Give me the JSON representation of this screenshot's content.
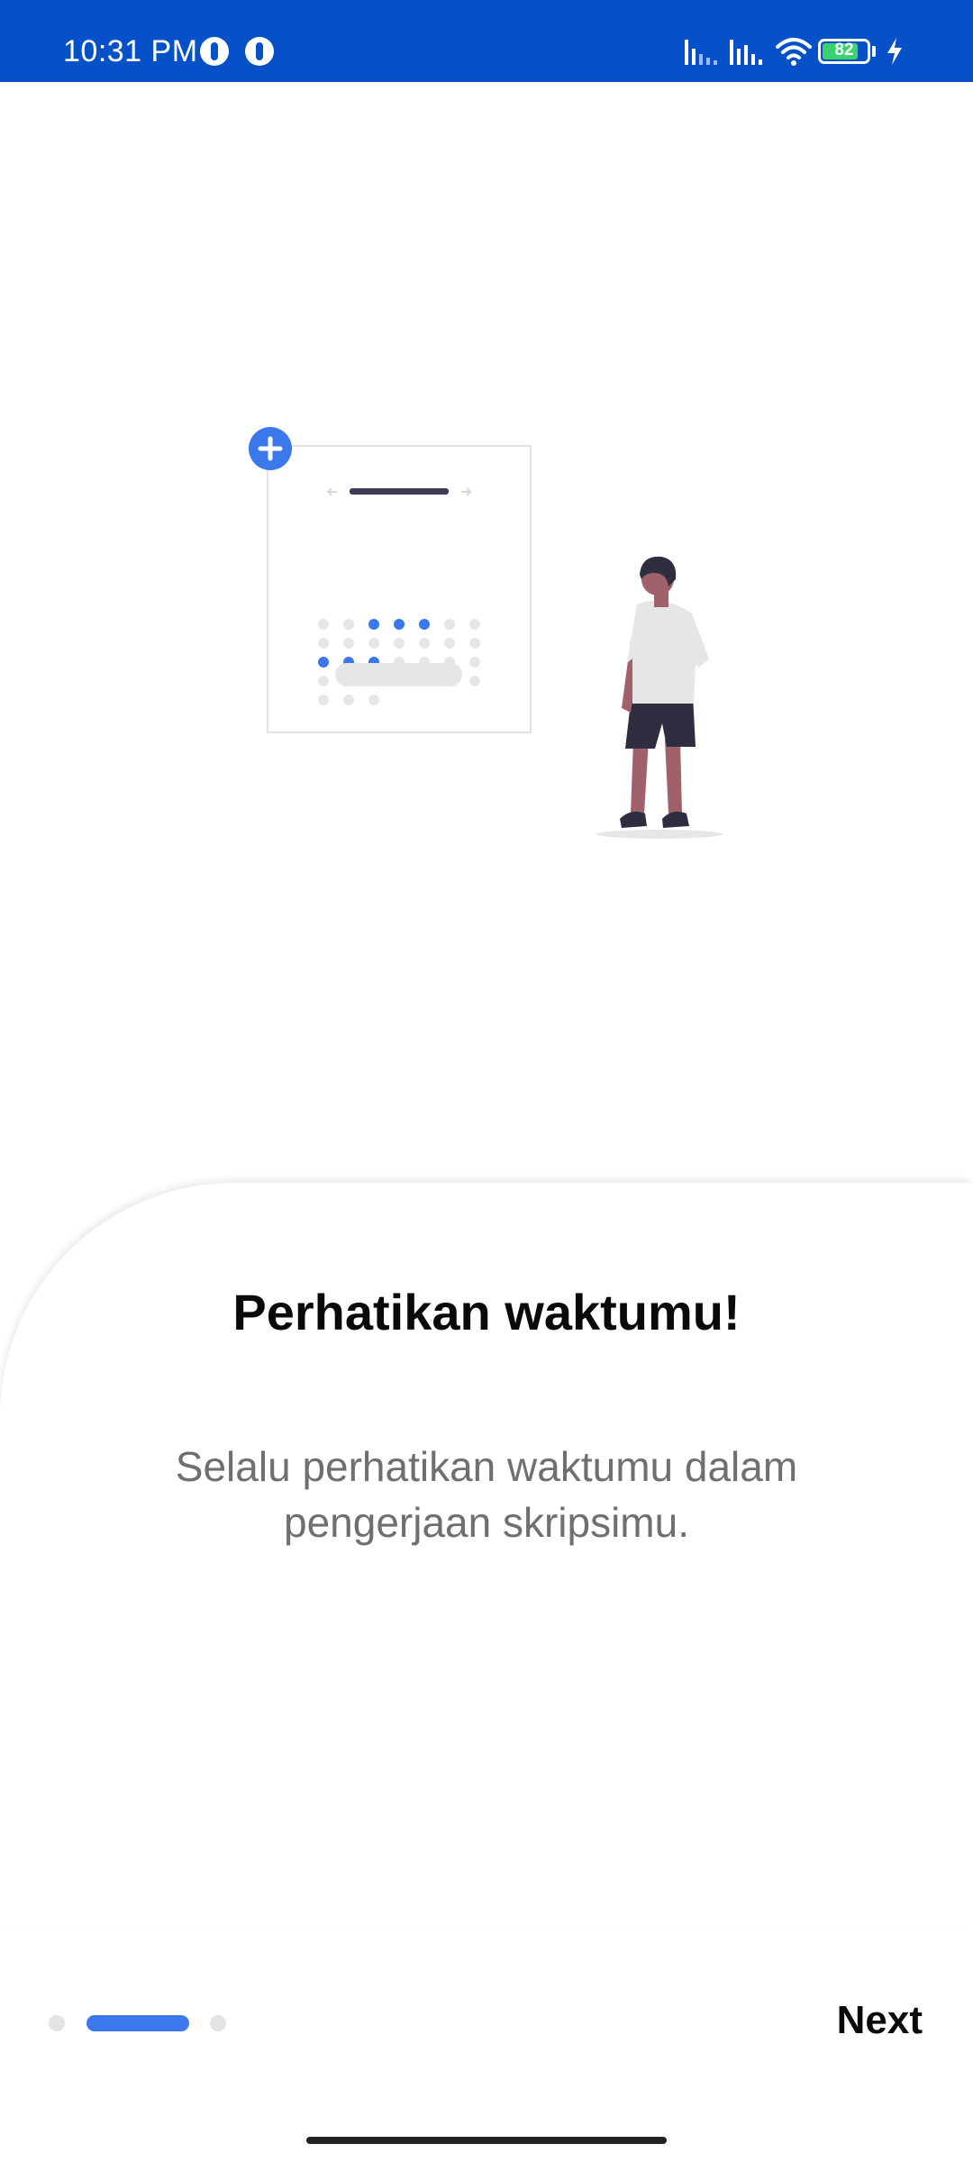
{
  "status_bar": {
    "time": "10:31 PM",
    "battery_percent": "82",
    "battery_level": 0.82,
    "background_color": "#0650c8",
    "icons": [
      "app-icon",
      "app-icon",
      "signal-icon",
      "signal-icon",
      "wifi-icon",
      "battery-icon",
      "charging-icon"
    ]
  },
  "illustration": {
    "name": "calendar-with-person",
    "accent_color": "#3a78ec"
  },
  "card": {
    "title": "Perhatikan waktumu!",
    "description": "Selalu perhatikan waktumu dalam pengerjaan skripsimu."
  },
  "pager": {
    "total_pages": 3,
    "current_page": 2,
    "next_label": "Next"
  }
}
